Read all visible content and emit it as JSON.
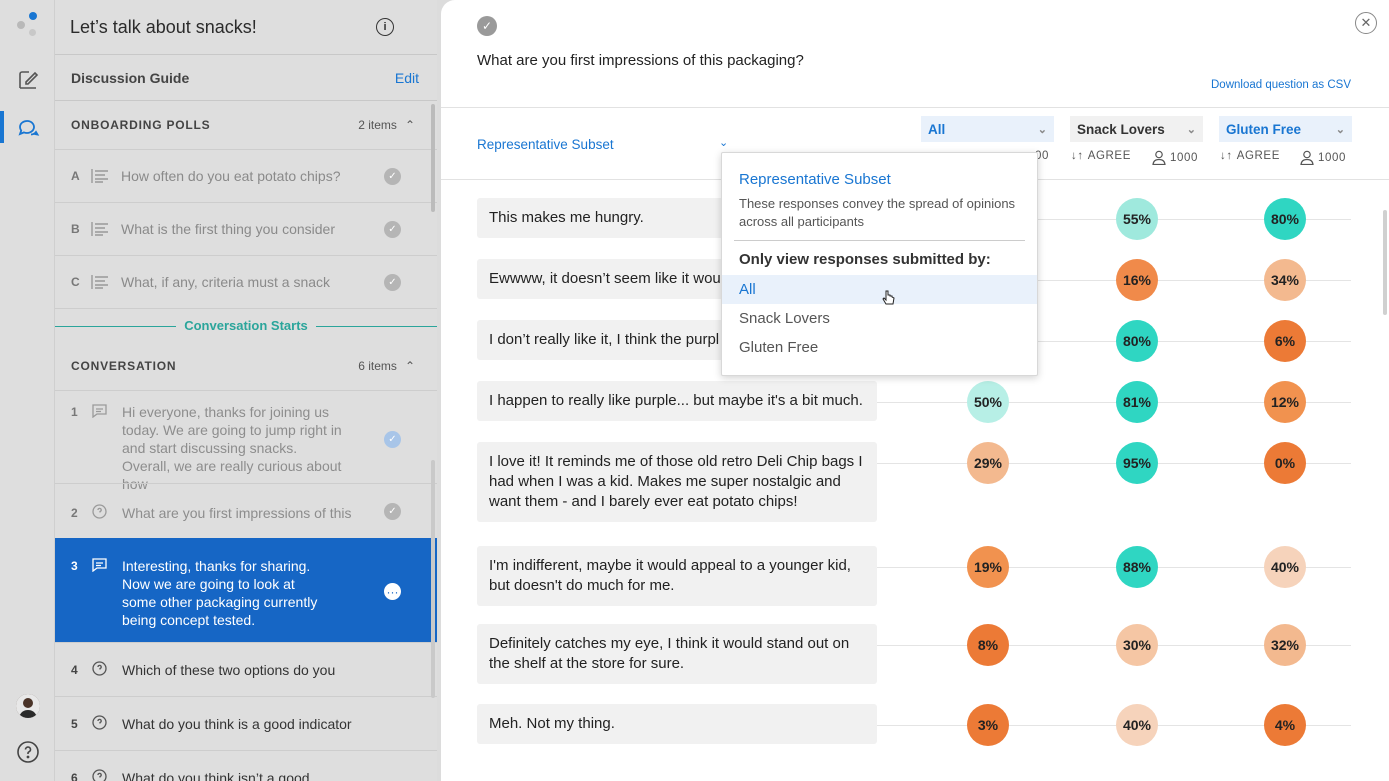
{
  "sidebar": {
    "title": "Let’s talk about snacks!",
    "guide_label": "Discussion Guide",
    "edit_label": "Edit",
    "onboarding": {
      "title": "ONBOARDING POLLS",
      "count": "2 items",
      "items": [
        {
          "letter": "A",
          "text": "How often do you eat potato chips?"
        },
        {
          "letter": "B",
          "text": "What is the first thing you consider"
        },
        {
          "letter": "C",
          "text": "What, if any, criteria must a snack"
        }
      ]
    },
    "conversation_starts": "Conversation Starts",
    "conversation": {
      "title": "CONVERSATION",
      "count": "6 items",
      "items": [
        {
          "num": "1",
          "text": "Hi everyone, thanks for joining us today. We are going to jump right in and start discussing snacks. Overall, we are really curious about how"
        },
        {
          "num": "2",
          "text": "What are you first impressions of this"
        },
        {
          "num": "3",
          "text": "Interesting, thanks for sharing. Now we are going to look at some other packaging currently being concept tested."
        },
        {
          "num": "4",
          "text": "Which of these two options do you"
        },
        {
          "num": "5",
          "text": "What do you think is a good indicator"
        },
        {
          "num": "6",
          "text": "What do you think isn’t a good"
        }
      ]
    }
  },
  "main": {
    "question": "What are you first impressions of this packaging?",
    "csv_link": "Download question as CSV",
    "subset_label": "Representative Subset",
    "columns": [
      {
        "label": "All",
        "agree": "AGREE",
        "count": "1000"
      },
      {
        "label": "Snack Lovers",
        "agree": "AGREE",
        "count": "1000"
      },
      {
        "label": "Gluten Free",
        "agree": "AGREE",
        "count": "1000"
      }
    ],
    "col1_partial_count": "00",
    "responses": [
      {
        "text": "This makes me hungry.",
        "values": [
          "",
          "55%",
          "80%"
        ]
      },
      {
        "text": "Ewwww, it doesn’t seem like it wou",
        "values": [
          "",
          "16%",
          "34%"
        ]
      },
      {
        "text": "I don’t really like it, I think the purpl",
        "values": [
          "",
          "80%",
          "6%"
        ]
      },
      {
        "text": "I happen to really like purple... but maybe it's a bit much.",
        "values": [
          "50%",
          "81%",
          "12%"
        ]
      },
      {
        "text": "I love it! It reminds me of those old retro Deli Chip bags I had when I was a kid. Makes me super nostalgic and want them - and I barely ever eat potato chips!",
        "values": [
          "29%",
          "95%",
          "0%"
        ]
      },
      {
        "text": "I'm indifferent, maybe it would appeal to a younger kid, but doesn't do much for me.",
        "values": [
          "19%",
          "88%",
          "40%"
        ]
      },
      {
        "text": "Definitely catches my eye, I think it would stand out on the shelf at the store for sure.",
        "values": [
          "8%",
          "30%",
          "32%"
        ]
      },
      {
        "text": "Meh. Not my thing.",
        "values": [
          "3%",
          "40%",
          "4%"
        ]
      }
    ]
  },
  "dropdown": {
    "title": "Representative Subset",
    "description": "These responses convey the spread of opinions across all participants",
    "label": "Only view responses submitted by:",
    "options": [
      "All",
      "Snack Lovers",
      "Gluten Free"
    ],
    "selected": "All"
  },
  "colors": {
    "accent": "#1976d2",
    "teal": "#2ba59b",
    "active_row": "#1666c5"
  }
}
